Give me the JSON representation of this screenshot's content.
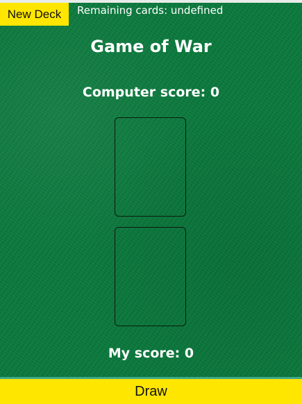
{
  "header": {
    "new_deck_label": "New Deck",
    "remaining_cards": "Remaining cards: undefined"
  },
  "game": {
    "title": "Game of War",
    "computer_score": "Computer score: 0",
    "my_score": "My score: 0"
  },
  "footer": {
    "draw_label": "Draw"
  },
  "colors": {
    "table_green": "#0a7a3d",
    "button_yellow": "#ffe600",
    "text_white": "#ffffff"
  }
}
